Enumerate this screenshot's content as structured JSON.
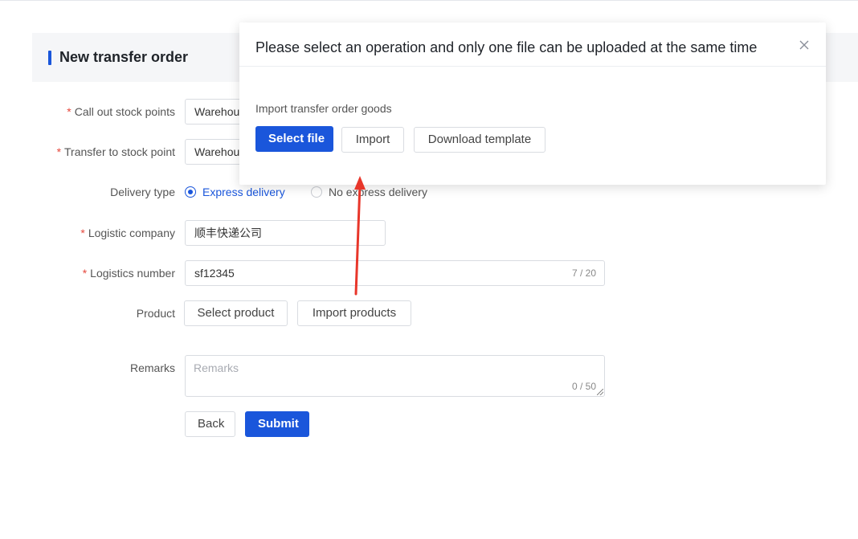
{
  "page": {
    "title": "New transfer order"
  },
  "form": {
    "call_out": {
      "label": "Call out stock points",
      "value": "Warehouse"
    },
    "transfer_to": {
      "label": "Transfer to stock point",
      "value": "Warehouse"
    },
    "delivery_type": {
      "label": "Delivery type",
      "options": [
        "Express delivery",
        "No express delivery"
      ],
      "selected": "Express delivery"
    },
    "logistic_company": {
      "label": "Logistic company",
      "value": "顺丰快递公司"
    },
    "logistics_number": {
      "label": "Logistics number",
      "value": "sf12345",
      "counter": "7 / 20"
    },
    "product": {
      "label": "Product",
      "select_label": "Select product",
      "import_label": "Import products"
    },
    "remarks": {
      "label": "Remarks",
      "placeholder": "Remarks",
      "counter": "0 / 50"
    },
    "required_mark": "*",
    "back_label": "Back",
    "submit_label": "Submit"
  },
  "modal": {
    "title": "Please select an operation and only one file can be uploaded at the same time",
    "subtitle": "Import transfer order goods",
    "select_file_label": "Select file",
    "import_label": "Import",
    "download_label": "Download template"
  },
  "colors": {
    "primary": "#1a56db",
    "required": "#e5483d",
    "annotation_arrow": "#e8362a"
  },
  "icons": {
    "close": "close-icon"
  }
}
